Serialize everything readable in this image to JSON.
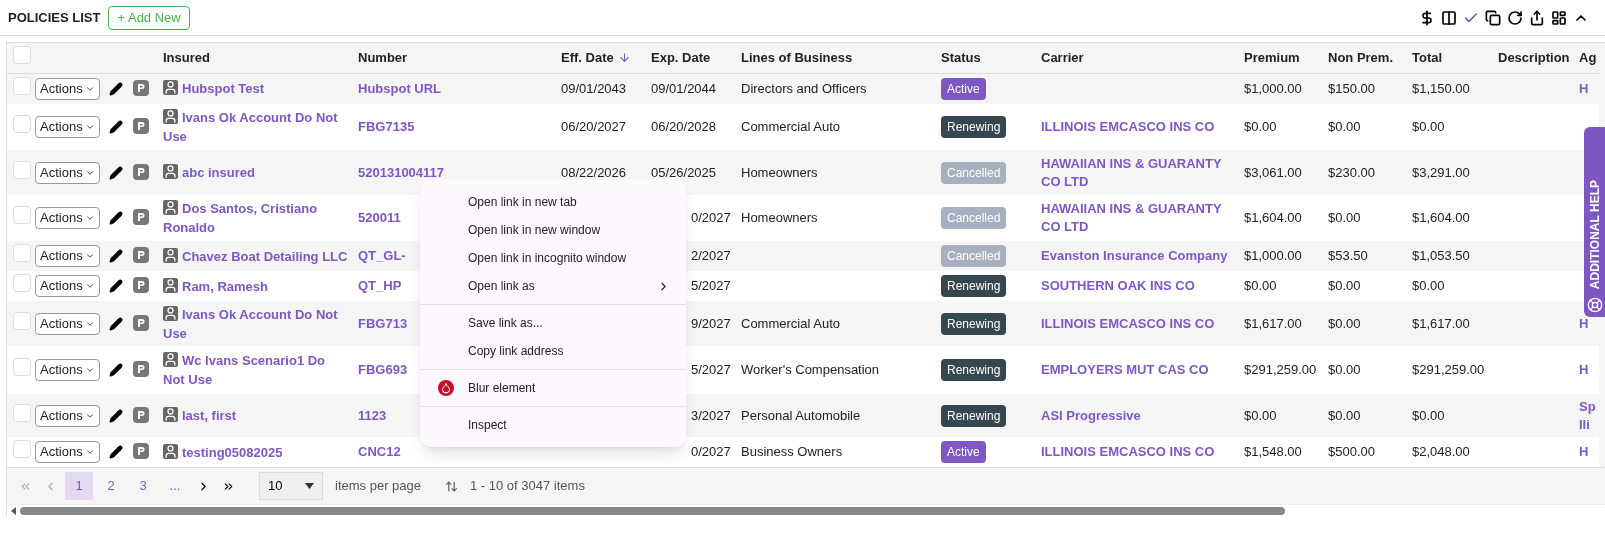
{
  "page": {
    "title": "POLICIES LIST",
    "add_button": "+ Add New"
  },
  "toolbar": {
    "icons": [
      {
        "kind": "dollar"
      },
      {
        "kind": "columns"
      },
      {
        "kind": "check"
      },
      {
        "kind": "copy"
      },
      {
        "kind": "refresh"
      },
      {
        "kind": "share"
      },
      {
        "kind": "layout"
      },
      {
        "kind": "collapse"
      }
    ]
  },
  "table": {
    "header_checkbox": {
      "checked": false
    },
    "columns": [
      {
        "label": "Insured",
        "sorted": false
      },
      {
        "label": "Number",
        "sorted": false
      },
      {
        "label": "Eff. Date",
        "sorted": true
      },
      {
        "label": "Exp. Date",
        "sorted": false
      },
      {
        "label": "Lines of Business",
        "sorted": false
      },
      {
        "label": "Status",
        "sorted": false
      },
      {
        "label": "Carrier",
        "sorted": false
      },
      {
        "label": "Premium",
        "sorted": false
      },
      {
        "label": "Non Prem.",
        "sorted": false
      },
      {
        "label": "Total",
        "sorted": false
      },
      {
        "label": "Description",
        "sorted": false
      },
      {
        "label": "Ag",
        "sorted": false
      }
    ],
    "rows": [
      {
        "checked": false,
        "actions": "Actions",
        "insured": "Hubspot Test",
        "number": "Hubspot URL",
        "eff_date": "09/01/2043",
        "exp_date": "09/01/2044",
        "lines": "Directors and Officers",
        "status": {
          "label": "Active",
          "kind": "active"
        },
        "carrier": "",
        "premium": "$1,000.00",
        "non_prem": "$150.00",
        "total": "$1,150.00",
        "column_12": "H"
      },
      {
        "checked": false,
        "actions": "Actions",
        "insured": "Ivans Ok Account Do Not Use",
        "number": "FBG7135",
        "eff_date": "06/20/2027",
        "exp_date": "06/20/2028",
        "lines": "Commercial Auto",
        "status": {
          "label": "Renewing",
          "kind": "renewing"
        },
        "carrier": "ILLINOIS EMCASCO INS CO",
        "premium": "$0.00",
        "non_prem": "$0.00",
        "total": "$0.00",
        "column_12": ""
      },
      {
        "checked": false,
        "actions": "Actions",
        "insured": "abc insured",
        "number": "520131004117",
        "eff_date": "08/22/2026",
        "exp_date": "05/26/2025",
        "lines": "Homeowners",
        "status": {
          "label": "Cancelled",
          "kind": "cancelled"
        },
        "carrier": "HAWAIIAN INS & GUARANTY CO LTD",
        "premium": "$3,061.00",
        "non_prem": "$230.00",
        "total": "$3,291.00",
        "column_12": ""
      },
      {
        "checked": false,
        "actions": "Actions",
        "insured": "Dos Santos, Cristiano Ronaldo",
        "number": "520011",
        "eff_date": "",
        "exp_date": "0/2027",
        "lines": "Homeowners",
        "status": {
          "label": "Cancelled",
          "kind": "cancelled"
        },
        "carrier": "HAWAIIAN INS & GUARANTY CO LTD",
        "premium": "$1,604.00",
        "non_prem": "$0.00",
        "total": "$1,604.00",
        "column_12": ""
      },
      {
        "checked": false,
        "actions": "Actions",
        "insured": "Chavez Boat Detailing LLC",
        "number": "QT_GL-",
        "eff_date": "",
        "exp_date": "2/2027",
        "lines": "",
        "status": {
          "label": "Cancelled",
          "kind": "cancelled"
        },
        "carrier": "Evanston Insurance Company",
        "premium": "$1,000.00",
        "non_prem": "$53.50",
        "total": "$1,053.50",
        "column_12": ""
      },
      {
        "checked": false,
        "actions": "Actions",
        "insured": "Ram, Ramesh",
        "number": "QT_HP",
        "eff_date": "",
        "exp_date": "5/2027",
        "lines": "",
        "status": {
          "label": "Renewing",
          "kind": "renewing"
        },
        "carrier": "SOUTHERN OAK INS CO",
        "premium": "$0.00",
        "non_prem": "$0.00",
        "total": "$0.00",
        "column_12": ""
      },
      {
        "checked": false,
        "actions": "Actions",
        "insured": "Ivans Ok Account Do Not Use",
        "number": "FBG713",
        "eff_date": "",
        "exp_date": "9/2027",
        "lines": "Commercial Auto",
        "status": {
          "label": "Renewing",
          "kind": "renewing"
        },
        "carrier": "ILLINOIS EMCASCO INS CO",
        "premium": "$1,617.00",
        "non_prem": "$0.00",
        "total": "$1,617.00",
        "column_12": "H"
      },
      {
        "checked": false,
        "actions": "Actions",
        "insured": "Wc Ivans Scenario1 Do Not Use",
        "number": "FBG693",
        "eff_date": "",
        "exp_date": "5/2027",
        "lines": "Worker's Compensation",
        "status": {
          "label": "Renewing",
          "kind": "renewing"
        },
        "carrier": "EMPLOYERS MUT CAS CO",
        "premium": "$291,259.00",
        "non_prem": "$0.00",
        "total": "$291,259.00",
        "column_12": "H"
      },
      {
        "checked": false,
        "actions": "Actions",
        "insured": "last, first",
        "number": "1123",
        "eff_date": "",
        "exp_date": "3/2027",
        "lines": "Personal Automobile",
        "status": {
          "label": "Renewing",
          "kind": "renewing"
        },
        "carrier": "ASI Progressive",
        "premium": "$0.00",
        "non_prem": "$0.00",
        "total": "$0.00",
        "column_12": "Sp Ili"
      },
      {
        "checked": false,
        "actions": "Actions",
        "insured": "testing05082025",
        "number": "CNC12",
        "eff_date": "",
        "exp_date": "0/2027",
        "lines": "Business Owners",
        "status": {
          "label": "Active",
          "kind": "active"
        },
        "carrier": "ILLINOIS EMCASCO INS CO",
        "premium": "$1,548.00",
        "non_prem": "$500.00",
        "total": "$2,048.00",
        "column_12": "H"
      }
    ]
  },
  "pager": {
    "pages": [
      {
        "label": "1",
        "selected": true
      },
      {
        "label": "2",
        "selected": false
      },
      {
        "label": "3",
        "selected": false
      },
      {
        "label": "...",
        "selected": false
      }
    ],
    "page_size": "10",
    "page_size_label": "items per page",
    "summary": "1 - 10 of 3047 items"
  },
  "context_menu": {
    "groups": [
      [
        {
          "label": "Open link in new tab",
          "kind": "plain",
          "submenu": false
        },
        {
          "label": "Open link in new window",
          "kind": "plain",
          "submenu": false
        },
        {
          "label": "Open link in incognito window",
          "kind": "plain",
          "submenu": false
        },
        {
          "label": "Open link as",
          "kind": "plain",
          "submenu": true
        }
      ],
      [
        {
          "label": "Save link as...",
          "kind": "plain",
          "submenu": false
        },
        {
          "label": "Copy link address",
          "kind": "plain",
          "submenu": false
        }
      ],
      [
        {
          "label": "Blur element",
          "kind": "extension",
          "submenu": false
        }
      ],
      [
        {
          "label": "Inspect",
          "kind": "plain",
          "submenu": false
        }
      ]
    ]
  },
  "side_tab": {
    "label": "ADDITIONAL HELP"
  }
}
